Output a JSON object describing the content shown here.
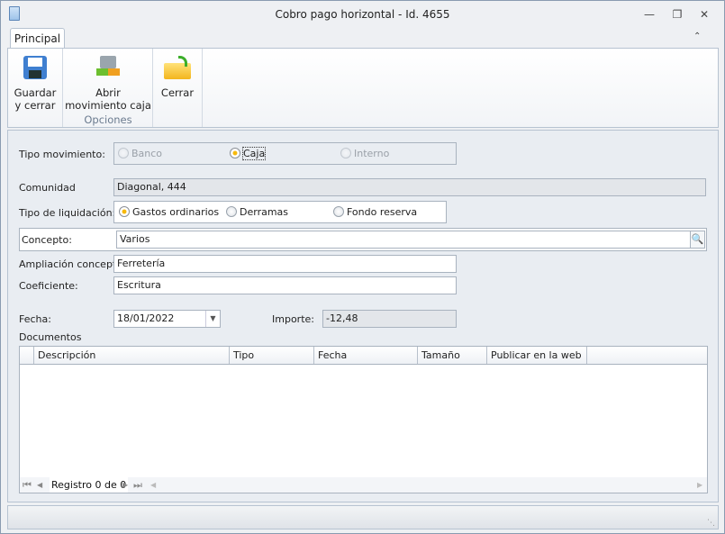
{
  "window": {
    "title": "Cobro pago horizontal - Id. 4655",
    "controls": [
      "minimize",
      "restore",
      "close"
    ]
  },
  "ribbon": {
    "tab": "Principal",
    "buttons": [
      {
        "label1": "Guardar",
        "label2": "y cerrar",
        "icon": "save-floppy-icon"
      },
      {
        "label1": "Abrir",
        "label2": "movimiento caja",
        "icon": "cash-register-icon"
      },
      {
        "label1": "Cerrar",
        "label2": "",
        "icon": "open-folder-arrow-icon"
      }
    ],
    "group_caption": "Opciones"
  },
  "form": {
    "tipo_movimiento": {
      "label": "Tipo movimiento:",
      "options": [
        "Banco",
        "Caja",
        "Interno"
      ],
      "selected": "Caja"
    },
    "comunidad": {
      "label": "Comunidad",
      "value": "Diagonal, 444"
    },
    "tipo_liquidacion": {
      "label": "Tipo de liquidación:",
      "options": [
        "Gastos ordinarios",
        "Derramas",
        "Fondo reserva"
      ],
      "selected": "Gastos ordinarios"
    },
    "concepto": {
      "label": "Concepto:",
      "value": "Varios"
    },
    "ampliacion": {
      "label": "Ampliación concepto:",
      "value": "Ferretería"
    },
    "coeficiente": {
      "label": "Coeficiente:",
      "value": "Escritura"
    },
    "fecha": {
      "label": "Fecha:",
      "value": "18/01/2022"
    },
    "importe": {
      "label": "Importe:",
      "value": "-12,48"
    }
  },
  "documentos": {
    "label": "Documentos",
    "columns": [
      "Descripción",
      "Tipo",
      "Fecha",
      "Tamaño",
      "Publicar en la web"
    ],
    "rows": [],
    "navigator": "Registro 0 de 0"
  }
}
